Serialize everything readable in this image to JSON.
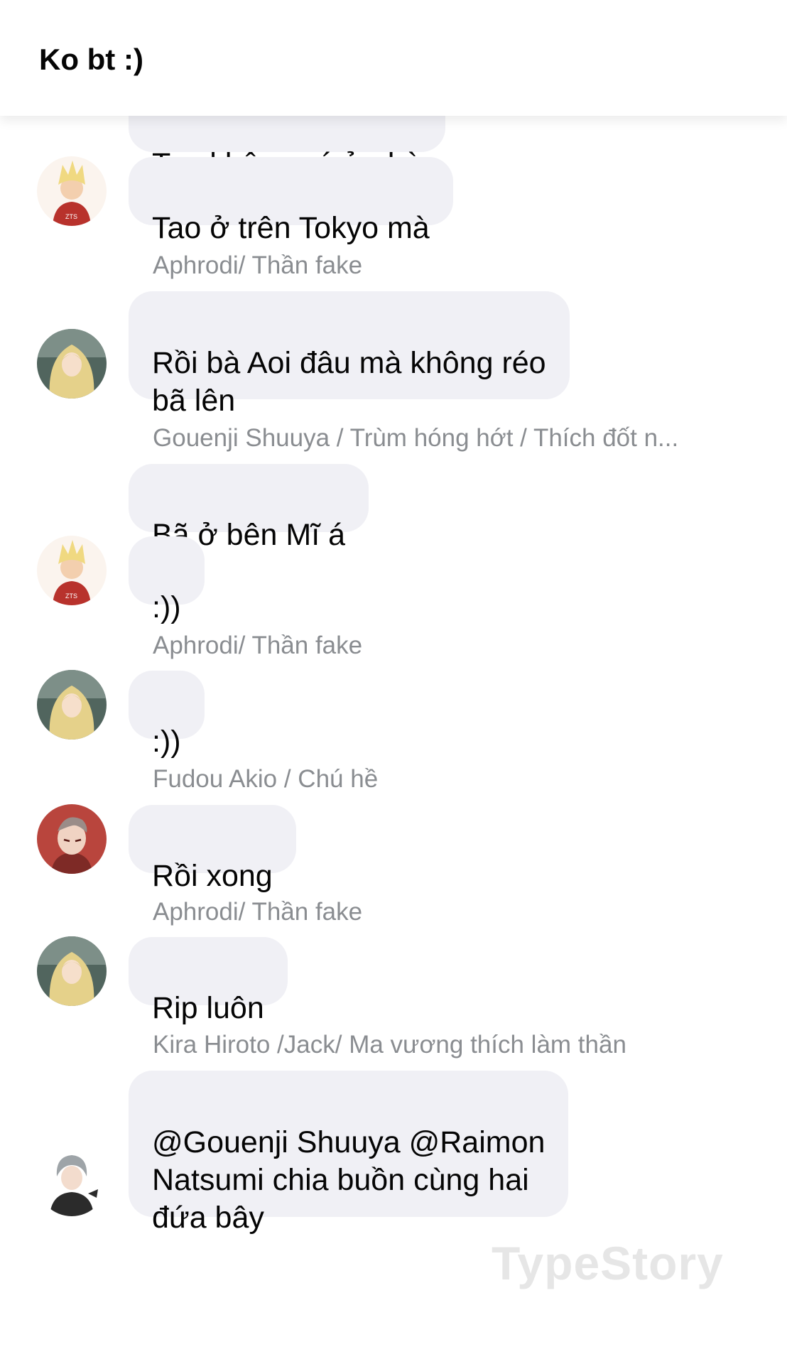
{
  "header": {
    "title": "Ko bt :)"
  },
  "messages": [
    {
      "text": "Tao không có ở nhà"
    },
    {
      "text": "Tao ở trên Tokyo mà"
    },
    {
      "sender": "Aphrodi/ Thần fake",
      "text": "Rồi bà Aoi đâu mà không réo\nbã lên"
    },
    {
      "sender": "Gouenji Shuuya / Trùm hóng hớt / Thích đốt n...",
      "text": "Bã ở bên Mĩ á"
    },
    {
      "text": ":))"
    },
    {
      "sender": "Aphrodi/ Thần fake",
      "text": ":))"
    },
    {
      "sender": "Fudou Akio / Chú hề",
      "text": "Rồi xong"
    },
    {
      "sender": "Aphrodi/ Thần fake",
      "text": "Rip luôn"
    },
    {
      "sender": "Kira Hiroto /Jack/ Ma vương thích làm thần",
      "text": "@Gouenji Shuuya @Raimon\nNatsumi chia buồn cùng hai\nđứa bây"
    }
  ],
  "avatars": [
    {
      "icon": "gouenji-avatar-icon",
      "color": "#b8322c"
    },
    {
      "icon": "aphrodi-avatar-icon",
      "color": "#6f7f78"
    },
    {
      "icon": "gouenji-avatar-icon",
      "color": "#b8322c"
    },
    {
      "icon": "aphrodi-avatar-icon",
      "color": "#6f7f78"
    },
    {
      "icon": "fudou-avatar-icon",
      "color": "#b9453d"
    },
    {
      "icon": "aphrodi-avatar-icon",
      "color": "#6f7f78"
    },
    {
      "icon": "hiroto-avatar-icon",
      "color": "#2b2b2b"
    }
  ],
  "watermark": "TypeStory"
}
